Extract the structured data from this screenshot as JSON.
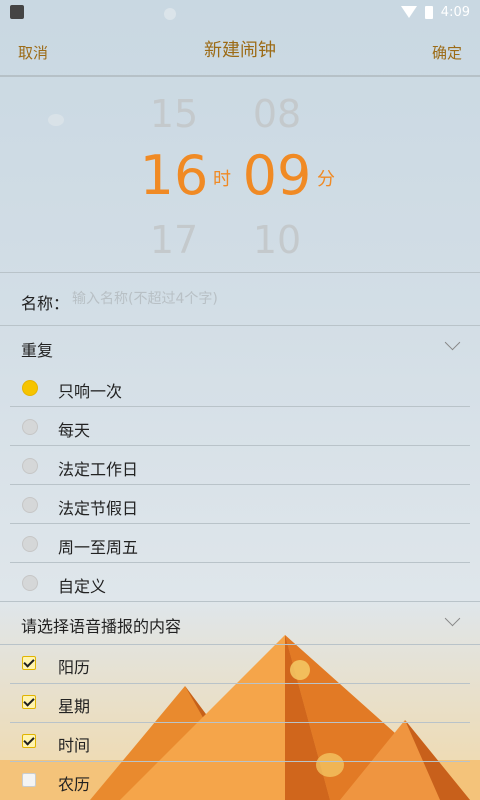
{
  "status": {
    "time": "4:09"
  },
  "titlebar": {
    "cancel": "取消",
    "title": "新建闹钟",
    "confirm": "确定"
  },
  "picker": {
    "hour_prev": "15",
    "hour_sel": "16",
    "hour_next": "17",
    "hour_unit": "时",
    "min_prev": "08",
    "min_sel": "09",
    "min_next": "10",
    "min_unit": "分"
  },
  "name": {
    "label": "名称：",
    "placeholder": "输入名称(不超过4个字)"
  },
  "repeat": {
    "title": "重复",
    "options": [
      {
        "label": "只响一次",
        "selected": true
      },
      {
        "label": "每天",
        "selected": false
      },
      {
        "label": "法定工作日",
        "selected": false
      },
      {
        "label": "法定节假日",
        "selected": false
      },
      {
        "label": "周一至周五",
        "selected": false
      },
      {
        "label": "自定义",
        "selected": false
      }
    ]
  },
  "voice": {
    "title": "请选择语音播报的内容",
    "options": [
      {
        "label": "阳历",
        "checked": true
      },
      {
        "label": "星期",
        "checked": true
      },
      {
        "label": "时间",
        "checked": true
      },
      {
        "label": "农历",
        "checked": false
      }
    ]
  },
  "colors": {
    "accent": "#f08a24",
    "title_text": "#9c6b16",
    "radio_on": "#f6c400"
  }
}
